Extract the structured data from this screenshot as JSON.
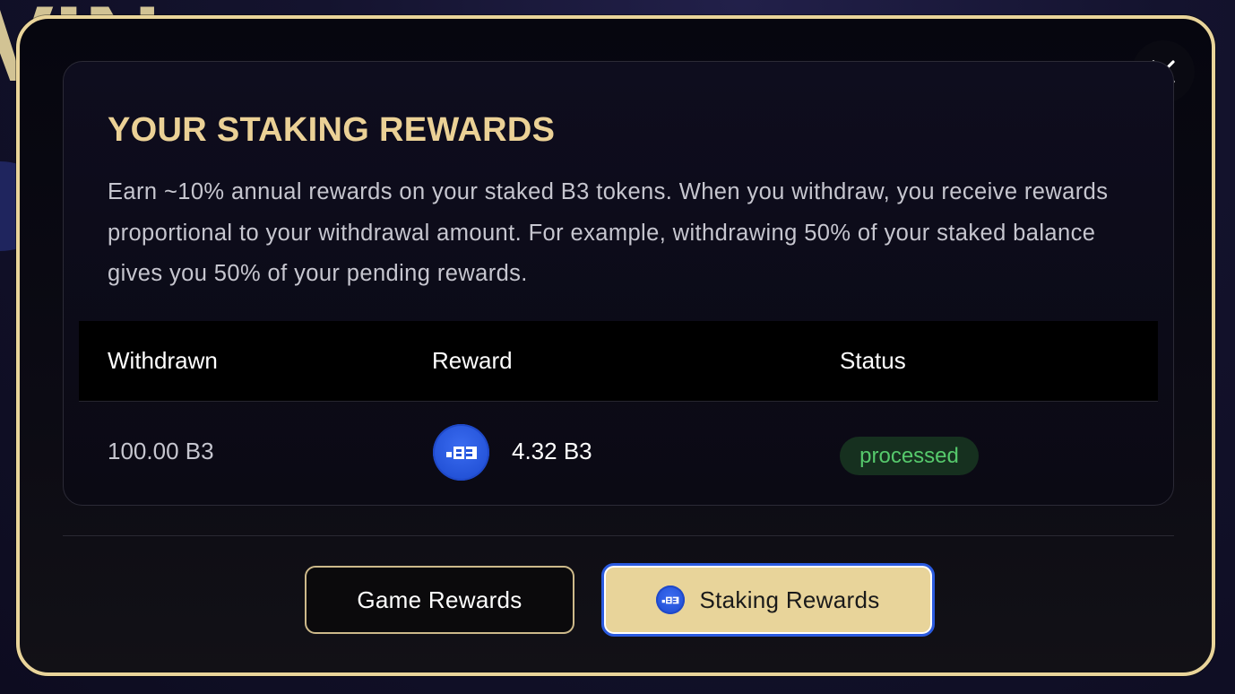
{
  "background": {
    "partial_text": "VIN"
  },
  "modal": {
    "title": "YOUR STAKING REWARDS",
    "description": "Earn ~10% annual rewards on your staked B3 tokens. When you withdraw, you receive rewards proportional to your withdrawal amount. For example, withdrawing 50% of your staked balance gives you 50% of your pending rewards.",
    "close_icon": "close-icon",
    "table": {
      "headers": {
        "withdrawn": "Withdrawn",
        "reward": "Reward",
        "status": "Status"
      },
      "rows": [
        {
          "withdrawn": "100.00 B3",
          "reward": "4.32 B3",
          "reward_icon": "b3-token-icon",
          "status": "processed"
        }
      ]
    },
    "tabs": {
      "game_label": "Game Rewards",
      "staking_label": "Staking Rewards",
      "active": "staking"
    }
  },
  "colors": {
    "accent_gold": "#e9d49a",
    "title_gold": "#ebd196",
    "token_blue": "#2453d8",
    "status_green": "#56c96c",
    "active_border": "#2b5be0"
  }
}
